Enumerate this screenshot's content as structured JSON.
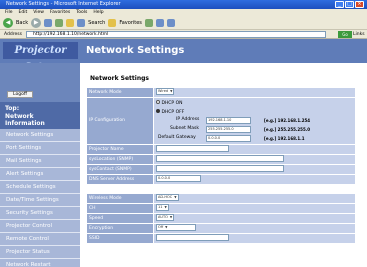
{
  "browser": {
    "title": "Network Settings - Microsoft Internet Explorer",
    "menu": [
      "File",
      "Edit",
      "View",
      "Favorites",
      "Tools",
      "Help"
    ],
    "back_label": "Back",
    "search_label": "Search",
    "favorites_label": "Favorites",
    "address_label": "Address",
    "address_value": "http://192.168.1.10/network.html",
    "go_label": "Go",
    "links_label": "Links"
  },
  "header": {
    "logo_text": "Projector Setup",
    "page_title": "Network Settings"
  },
  "sidebar": {
    "logoff_label": "Logoff",
    "top_item": [
      "Top:",
      "Network",
      "Information"
    ],
    "items": [
      "Network Settings",
      "Port Settings",
      "Mail Settings",
      "Alert Settings",
      "Schedule Settings",
      "Date/Time Settings",
      "Security Settings",
      "Projector Control",
      "Remote Control",
      "Projector Status",
      "Network Restart"
    ]
  },
  "section_title": "Network Settings",
  "form": {
    "network_mode": {
      "label": "Network Mode",
      "value": "Wired"
    },
    "ip_config": {
      "label": "IP Configuration",
      "dhcp_on": "DHCP ON",
      "dhcp_off": "DHCP OFF",
      "ip_address_label": "IP Address",
      "ip_address_value": "192.168.1.10",
      "ip_example": "[e.g.] 192.168.1.254",
      "subnet_label": "Subnet Mask",
      "subnet_value": "255.255.255.0",
      "subnet_example": "[e.g.] 255.255.255.0",
      "gateway_label": "Default Gateway",
      "gateway_value": "0.0.0.0",
      "gateway_example": "[e.g.] 192.168.1.1"
    },
    "projector_name": {
      "label": "Projector Name",
      "value": ""
    },
    "sys_location": {
      "label": "sysLocation (SNMP)",
      "value": ""
    },
    "sys_contact": {
      "label": "sysContact (SNMP)",
      "value": ""
    },
    "dns_server": {
      "label": "DNS Server Address",
      "value": "0.0.0.0"
    },
    "wireless_mode": {
      "label": "Wireless Mode",
      "value": "AD-HOC"
    },
    "ch": {
      "label": "CH",
      "value": "11"
    },
    "speed": {
      "label": "Speed",
      "value": "AUTO"
    },
    "encryption": {
      "label": "Encryption",
      "value": "Off"
    },
    "ssid": {
      "label": "SSID",
      "value": ""
    }
  },
  "colors": {
    "header": "#5f7cb8",
    "sidebar": "#6c86bb",
    "sidebar_item": "#a8b7d8",
    "label_cell": "#96a9d0",
    "value_cell": "#c6d1ea"
  }
}
